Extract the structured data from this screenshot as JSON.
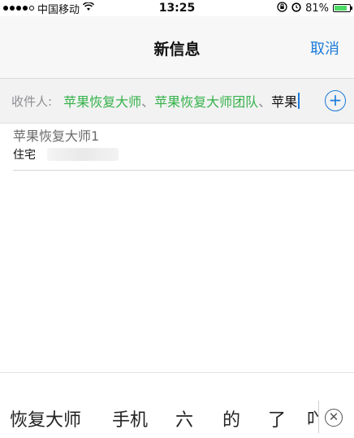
{
  "status_bar": {
    "carrier": "中国移动",
    "time": "13:25",
    "battery": "81%",
    "battery_level": 0.81,
    "signal_dots_filled": 4,
    "signal_dots_total": 5,
    "icons": [
      "wifi-icon",
      "rotation-lock-icon",
      "alarm-icon",
      "battery-icon"
    ]
  },
  "nav": {
    "title": "新信息",
    "cancel": "取消"
  },
  "recipient_field": {
    "label": "收件人:",
    "recipients": [
      "苹果恢复大师",
      "苹果恢复大师团队"
    ],
    "separator": "、",
    "typed_text": "苹果",
    "add_icon": "plus-circle-icon"
  },
  "suggestions": [
    {
      "name": "苹果恢复大师1",
      "type": "住宅"
    }
  ],
  "candidates": {
    "items": [
      "恢复大师",
      "手机",
      "六",
      "的",
      "了",
      "吖"
    ],
    "clear_icon": "clear-x-icon"
  },
  "colors": {
    "accent": "#1a7ad9",
    "recipient": "#35b24a",
    "battery": "#4cd964"
  }
}
